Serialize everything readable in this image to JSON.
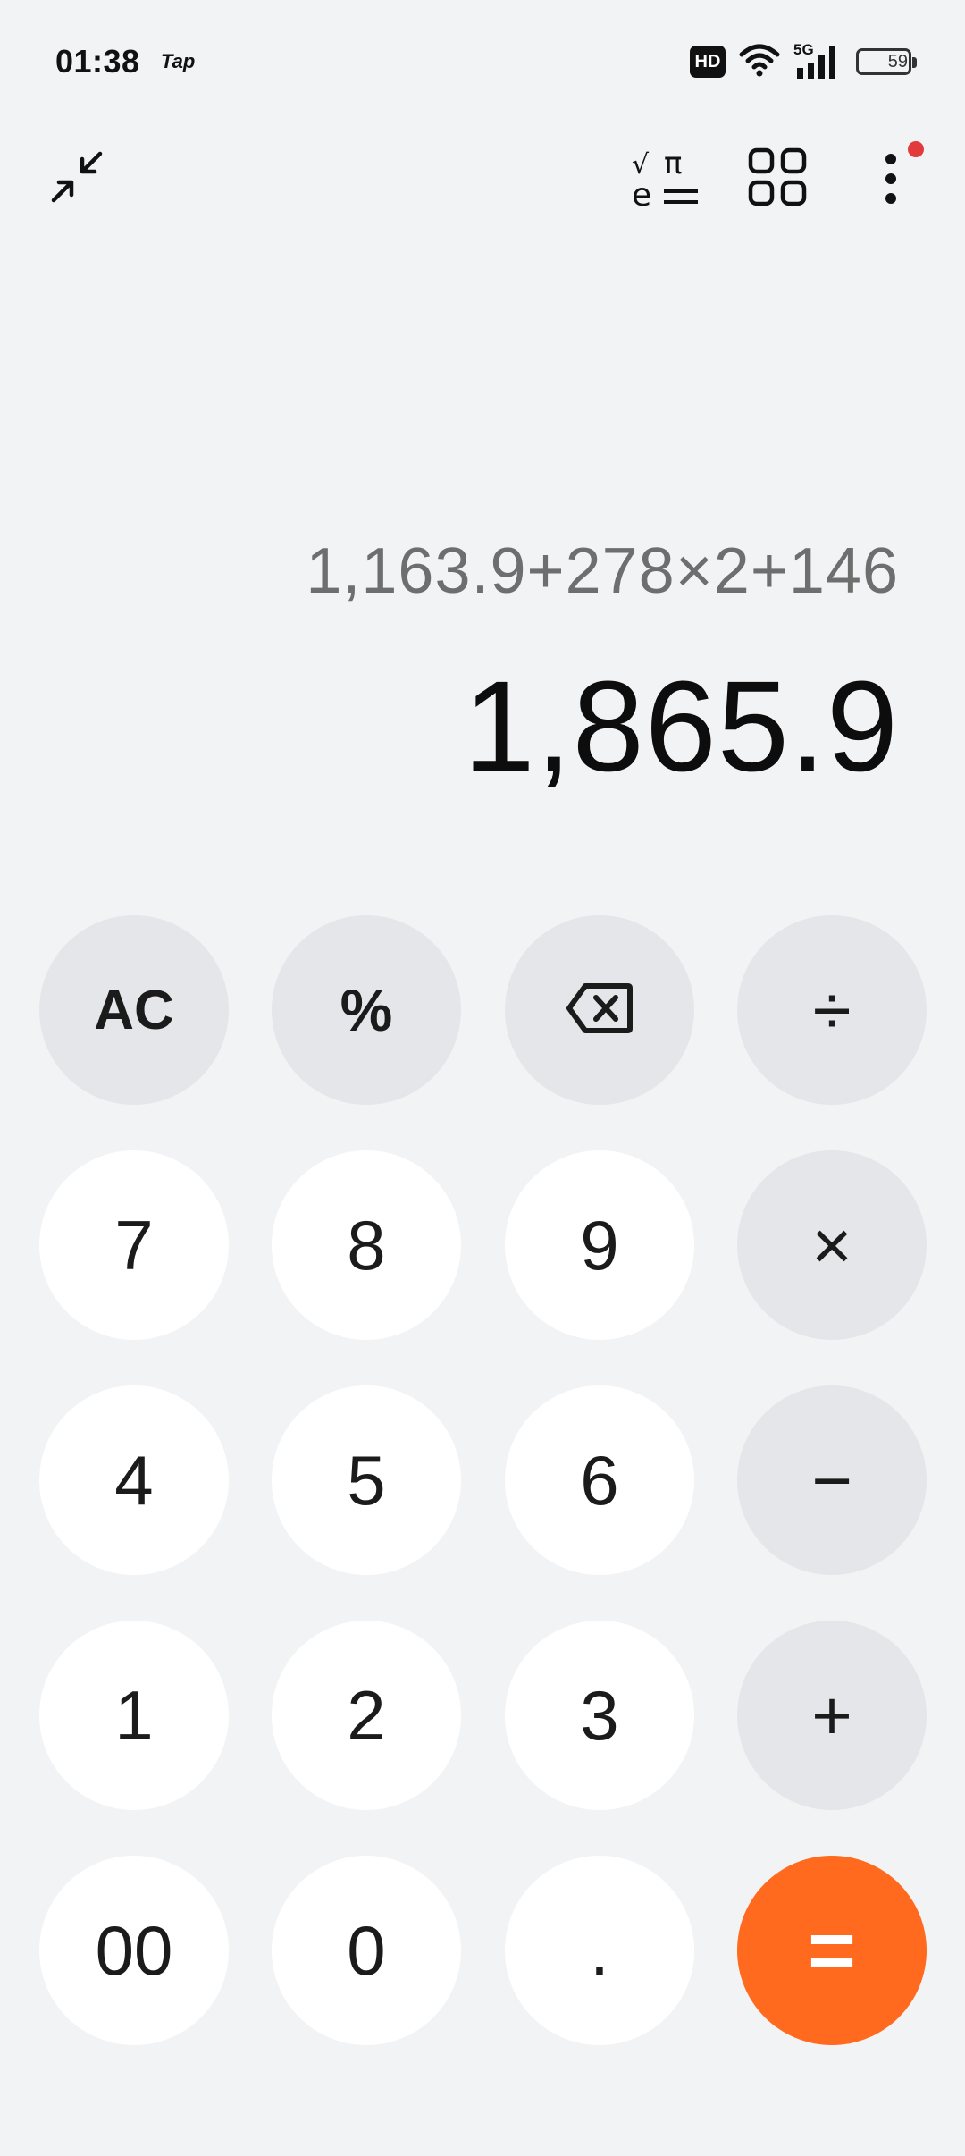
{
  "status_bar": {
    "time": "01:38",
    "app_label": "Tap",
    "hd": "HD",
    "network": "5G",
    "battery": "59",
    "battery_level_percent": 59
  },
  "toolbar": {
    "collapse": "collapse-icon",
    "scientific": "scientific-mode-icon",
    "converter": "converter-grid-icon",
    "more": "more-options-icon"
  },
  "display": {
    "expression": "1,163.9+278×2+146",
    "result": "1,865.9"
  },
  "keys": {
    "ac": "AC",
    "percent": "%",
    "divide": "÷",
    "k7": "7",
    "k8": "8",
    "k9": "9",
    "multiply": "×",
    "k4": "4",
    "k5": "5",
    "k6": "6",
    "minus": "−",
    "k1": "1",
    "k2": "2",
    "k3": "3",
    "plus": "+",
    "k00": "00",
    "k0": "0",
    "dot": ".",
    "equals": "="
  },
  "colors": {
    "background": "#f2f3f5",
    "number_key": "#ffffff",
    "function_key": "#e5e6e9",
    "equals_key": "#ff6a1f",
    "notification_dot": "#e23b3b"
  }
}
